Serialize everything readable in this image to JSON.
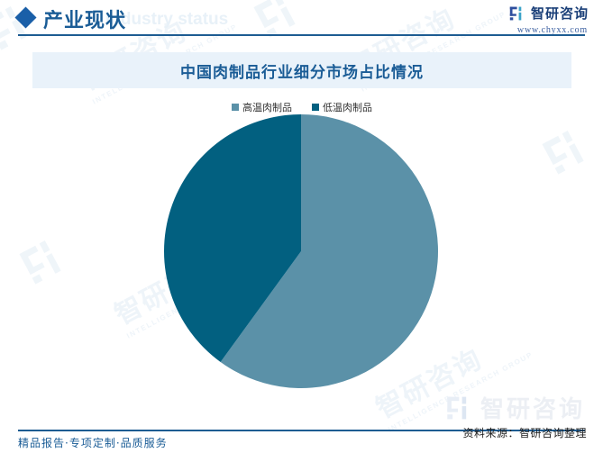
{
  "header": {
    "title_cn": "产业现状",
    "title_en": "Industry status",
    "diamond_icon": "diamond-icon"
  },
  "brand": {
    "name": "智研咨询",
    "url": "www.chyxx.com",
    "logo_icon": "zhiyan-logo-icon"
  },
  "chart": {
    "title": "中国肉制品行业细分市场占比情况",
    "legend": [
      {
        "label": "高温肉制品",
        "color": "#5b91a8"
      },
      {
        "label": "低温肉制品",
        "color": "#026080"
      }
    ]
  },
  "chart_data": {
    "type": "pie",
    "title": "中国肉制品行业细分市场占比情况",
    "labels": [
      "高温肉制品",
      "低温肉制品"
    ],
    "values": [
      60,
      40
    ],
    "colors": [
      "#5b91a8",
      "#026080"
    ],
    "unit": "%",
    "legend_position": "top",
    "start_angle_deg": 0,
    "direction": "clockwise",
    "show_data_labels": false
  },
  "footer": {
    "tagline": "精品报告·专项定制·品质服务",
    "source": "资料来源：智研咨询整理"
  },
  "watermark": {
    "text_cn": "智研咨询",
    "text_en": "INTELLIGENCE RESEARCH GROUP"
  }
}
